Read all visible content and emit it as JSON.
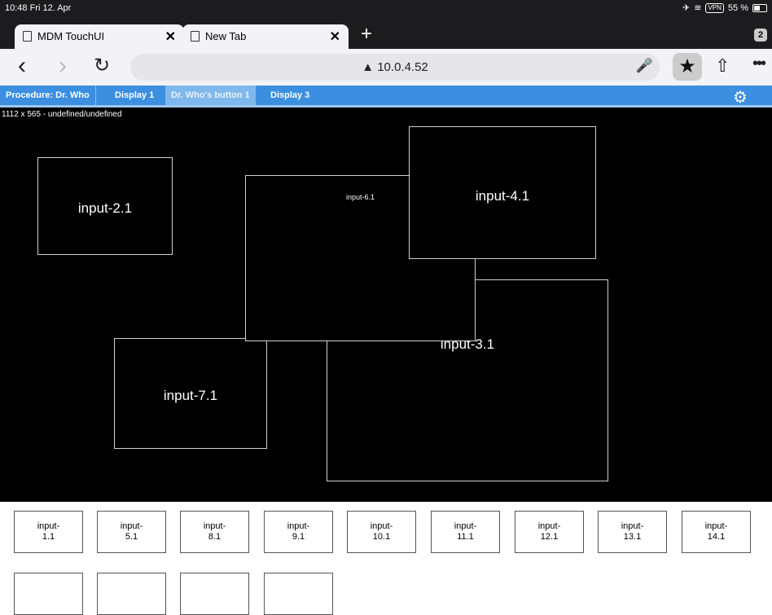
{
  "status": {
    "time": "10:48  Fri 12. Apr",
    "vpn": "VPN",
    "battery": "55 %"
  },
  "browser": {
    "tabs": [
      {
        "title": "MDM TouchUI"
      },
      {
        "title": "New Tab"
      }
    ],
    "tab_count": "2",
    "url": "10.0.4.52"
  },
  "app": {
    "tabs": [
      {
        "label": "Procedure: Dr. Who"
      },
      {
        "label": "Display 1"
      },
      {
        "label": "Dr. Who's button 1"
      },
      {
        "label": "Display 3"
      }
    ],
    "selected_tab": "Dr. Who's button 1"
  },
  "canvas": {
    "dimensions_text": "1112 x 565 - undefined/undefined",
    "boxes": [
      {
        "label": "input-2.1"
      },
      {
        "label": "input-7.1"
      },
      {
        "label": "input-3.1"
      },
      {
        "label": "input-6.1"
      },
      {
        "label": "input-4.1"
      }
    ]
  },
  "input_buttons": [
    {
      "line1": "input-",
      "line2": "1.1"
    },
    {
      "line1": "input-",
      "line2": "5.1"
    },
    {
      "line1": "input-",
      "line2": "8.1"
    },
    {
      "line1": "input-",
      "line2": "9.1"
    },
    {
      "line1": "input-",
      "line2": "10.1"
    },
    {
      "line1": "input-",
      "line2": "11.1"
    },
    {
      "line1": "input-",
      "line2": "12.1"
    },
    {
      "line1": "input-",
      "line2": "13.1"
    },
    {
      "line1": "input-",
      "line2": "14.1"
    },
    {
      "line1": "",
      "line2": ""
    },
    {
      "line1": "",
      "line2": ""
    },
    {
      "line1": "",
      "line2": ""
    },
    {
      "line1": "",
      "line2": ""
    }
  ]
}
